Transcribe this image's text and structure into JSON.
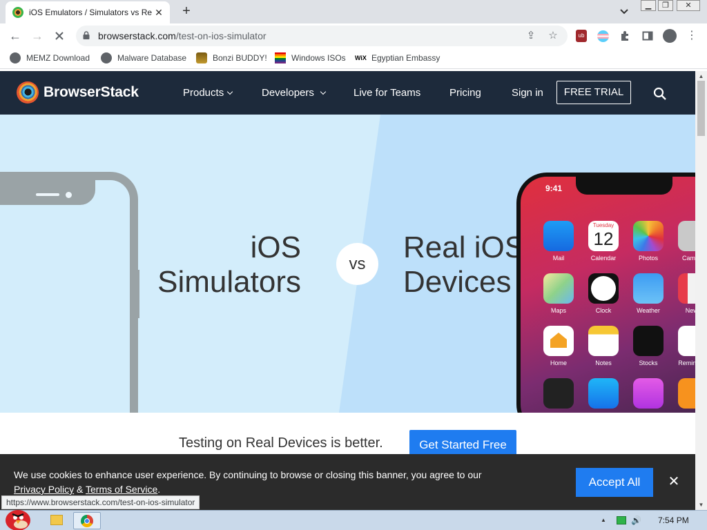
{
  "browser": {
    "tab_title": "iOS Emulators / Simulators vs Re",
    "url_domain": "browserstack.com",
    "url_path": "/test-on-ios-simulator",
    "status_url": "https://www.browserstack.com/test-on-ios-simulator"
  },
  "bookmarks": [
    {
      "label": "MEMZ Download"
    },
    {
      "label": "Malware Database"
    },
    {
      "label": "Bonzi BUDDY!"
    },
    {
      "label": "Windows ISOs"
    },
    {
      "label": "Egyptian Embassy"
    }
  ],
  "site": {
    "logo": "BrowserStack",
    "nav": {
      "products": "Products",
      "developers": "Developers",
      "live_for_teams": "Live for Teams",
      "pricing": "Pricing",
      "sign_in": "Sign in",
      "free_trial": "FREE TRIAL"
    },
    "hero": {
      "left_line1": "iOS",
      "left_line2": "Simulators",
      "vs": "vs",
      "right_line1": "Real iOS",
      "right_line2": "Devices",
      "phone_time": "9:41",
      "calendar_day": "Tuesday",
      "calendar_date": "12",
      "apps": [
        "Mail",
        "Calendar",
        "Photos",
        "Camera",
        "Maps",
        "Clock",
        "Weather",
        "News",
        "Home",
        "Notes",
        "Stocks",
        "Reminders"
      ]
    },
    "cta": {
      "text": "Testing on Real Devices is better.",
      "button": "Get Started Free"
    },
    "cookie": {
      "text": "We use cookies to enhance user experience. By continuing to browse or closing this banner, you agree to our",
      "privacy": "Privacy Policy",
      "amp": "&",
      "terms": "Terms of Service",
      "period": ".",
      "accept": "Accept All"
    }
  },
  "taskbar": {
    "time": "7:54 PM"
  },
  "colors": {
    "nav_bg": "#1d2a3b",
    "accent": "#1f7cf0",
    "hero_left": "#d3edfb",
    "hero_right": "#bde0fa"
  }
}
